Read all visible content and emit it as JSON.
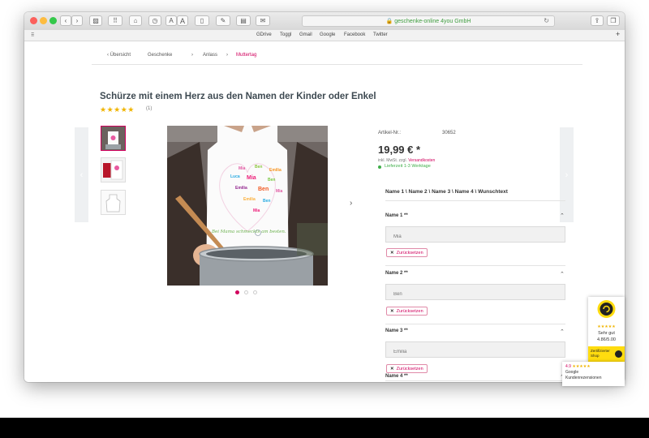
{
  "browser": {
    "url": "geschenke-online 4you GmbH",
    "lock_icon": "lock-icon",
    "favorites": [
      "GDrive",
      "Toggl",
      "Gmail",
      "Google",
      "Facebook",
      "Twitter"
    ]
  },
  "breadcrumb": {
    "back": "‹  Übersicht",
    "items": [
      "Geschenke",
      "Anlass",
      "Muttertag"
    ],
    "separator": "›"
  },
  "product": {
    "title": "Schürze mit einem Herz aus den Namen der Kinder oder Enkel",
    "stars": "★★★★★",
    "rating_count": "(1)",
    "image_caption": "Bei Mama schmeckts am besten.",
    "heart_names": [
      "Mia",
      "Ben",
      "Emilia",
      "Luca",
      "Mia",
      "Ben",
      "Emilia",
      "Ben",
      "Mia",
      "Emilia",
      "Ben",
      "Mia"
    ]
  },
  "details": {
    "article_label": "Artikel-Nr.:",
    "article_no": "30652",
    "price": "19,99 € *",
    "tax_note": "inkl. MwSt. zzgl.",
    "shipping_link": "Versandkosten",
    "delivery": "Lieferzeit 1-3 Werktage"
  },
  "form": {
    "section_title": "Name 1 \\ Name 2 \\ Name 3 \\ Name 4 \\ Wunschtext",
    "reset_label": "Zurücksetzen",
    "fields": [
      {
        "label": "Name 1 **",
        "placeholder": "Mia"
      },
      {
        "label": "Name 2 **",
        "placeholder": "Ben"
      },
      {
        "label": "Name 3 **",
        "placeholder": "Emilia"
      },
      {
        "label": "Name 4 **",
        "placeholder": ""
      }
    ]
  },
  "trust_badge": {
    "stars": "★★★★★",
    "rating_text": "Sehr gut",
    "score": "4.86/5.00",
    "certified": "Zertifizierter Shop"
  },
  "google_badge": {
    "score": "4.9",
    "stars": "★★★★★",
    "line1": "Google",
    "line2": "Kundenrezensionen"
  },
  "colors": {
    "accent": "#d1005d",
    "star": "#f0b400",
    "success": "#3fae49"
  }
}
